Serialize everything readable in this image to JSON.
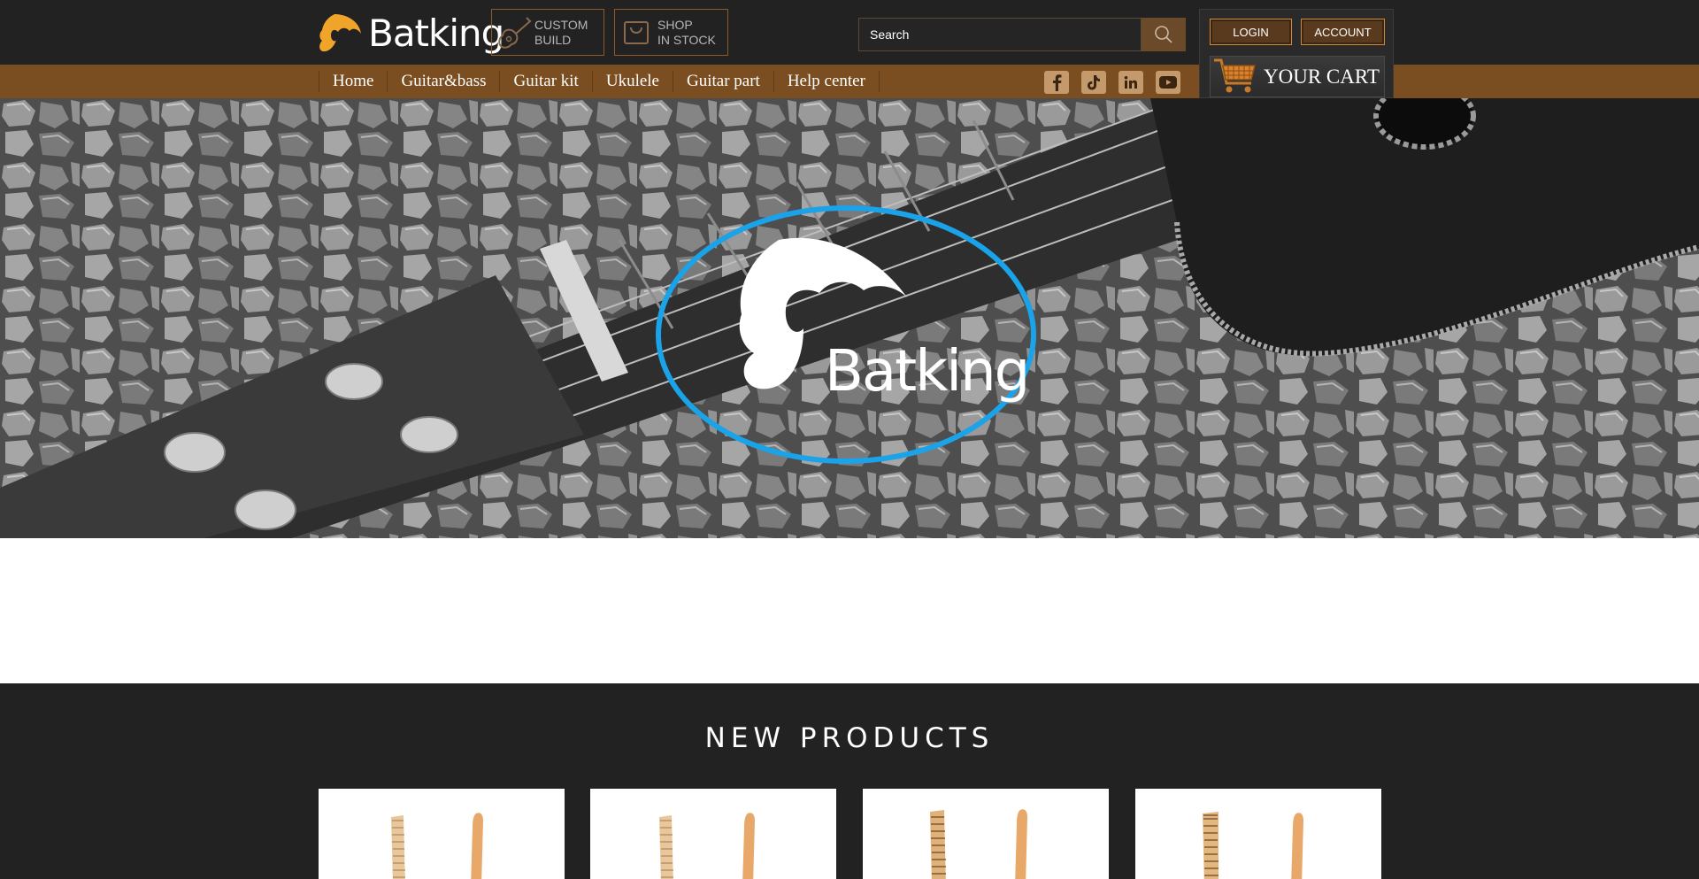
{
  "brand": {
    "name": "Batking"
  },
  "header": {
    "custom_build": {
      "line1": "CUSTOM",
      "line2": "BUILD"
    },
    "shop_stock": {
      "line1": "SHOP",
      "line2": "IN STOCK"
    },
    "search": {
      "placeholder": "Search"
    },
    "login_label": "LOGIN",
    "account_label": "ACCOUNT",
    "cart_label": "YOUR CART"
  },
  "nav": {
    "items": [
      "Home",
      "Guitar&bass",
      "Guitar kit",
      "Ukulele",
      "Guitar part",
      "Help center"
    ]
  },
  "social": [
    "facebook-icon",
    "tiktok-icon",
    "linkedin-icon",
    "youtube-icon"
  ],
  "hero": {
    "badge_text": "Batking"
  },
  "products": {
    "heading": "NEW PRODUCTS",
    "cards": [
      "product-1",
      "product-2",
      "product-3",
      "product-4"
    ]
  },
  "colors": {
    "header_bg": "#222222",
    "nav_bg": "#7a4e20",
    "accent_orange": "#f0a52a",
    "badge_ring": "#1aa3e8"
  }
}
